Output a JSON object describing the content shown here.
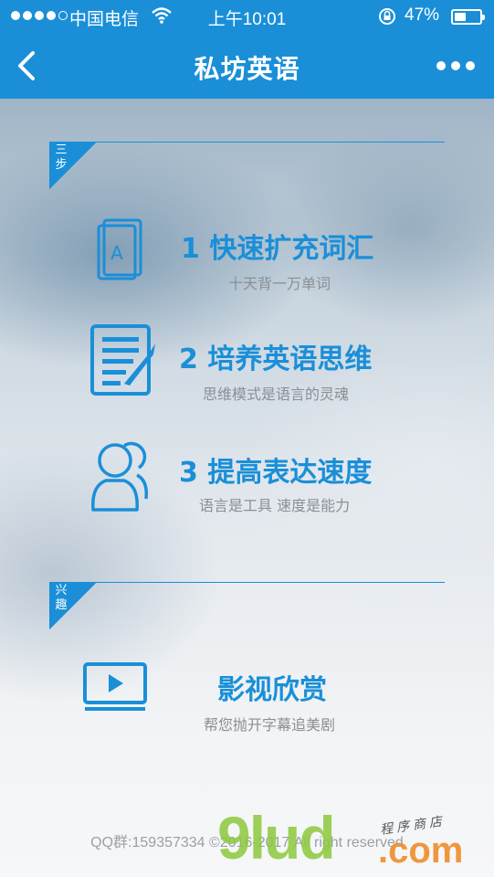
{
  "status_bar": {
    "carrier": "中国电信",
    "time": "上午10:01",
    "battery_percent": "47%",
    "battery_level": 0.47
  },
  "nav": {
    "title": "私坊英语",
    "back_icon": "chevron-left-icon",
    "more_icon": "more-dots-icon"
  },
  "sections": {
    "steps_tag": "三步",
    "interest_tag": "兴趣"
  },
  "features": [
    {
      "title": "1 快速扩充词汇",
      "subtitle": "十天背一万单词",
      "icon": "vocabulary-book-icon",
      "icon_letter": "A"
    },
    {
      "title": "2 培养英语思维",
      "subtitle": "思维模式是语言的灵魂",
      "icon": "notepad-pen-icon"
    },
    {
      "title": "3 提高表达速度",
      "subtitle": "语言是工具 速度是能力",
      "icon": "users-icon"
    }
  ],
  "interest": {
    "title": "影视欣赏",
    "subtitle": "帮您抛开字幕追美剧",
    "icon": "video-play-icon"
  },
  "footer": {
    "text": "QQ群:159357334 ©2016-2017 All right reserved"
  },
  "watermark": {
    "brand": "9lud",
    "domain": ".com",
    "tagline": "程序商店"
  },
  "colors": {
    "brand": "#1a8fd8",
    "subtitle": "#8a8f94"
  }
}
